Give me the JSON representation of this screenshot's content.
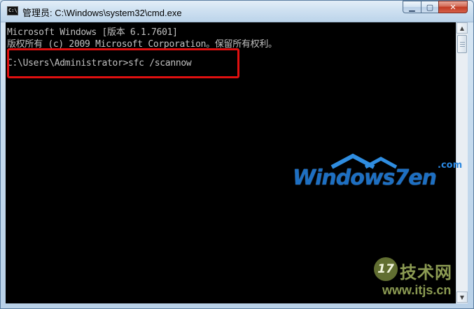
{
  "window": {
    "title": "管理员: C:\\Windows\\system32\\cmd.exe",
    "app_icon_text": "C:\\",
    "buttons": {
      "minimize": "▁",
      "maximize": "▢",
      "close": "✕"
    }
  },
  "console": {
    "lines": [
      "Microsoft Windows [版本 6.1.7601]",
      "版权所有 (c) 2009 Microsoft Corporation。保留所有权利。",
      "",
      "C:\\Users\\Administrator>sfc /scannow"
    ],
    "text_color": "#c0c0c0",
    "background": "#000000",
    "highlight_color": "#e01010"
  },
  "watermarks": {
    "windows7en": {
      "text": "Windows7en",
      "suffix": ".com"
    },
    "itjs": {
      "logo": "17",
      "name": "技术网",
      "url": "www.itjs.cn"
    }
  }
}
